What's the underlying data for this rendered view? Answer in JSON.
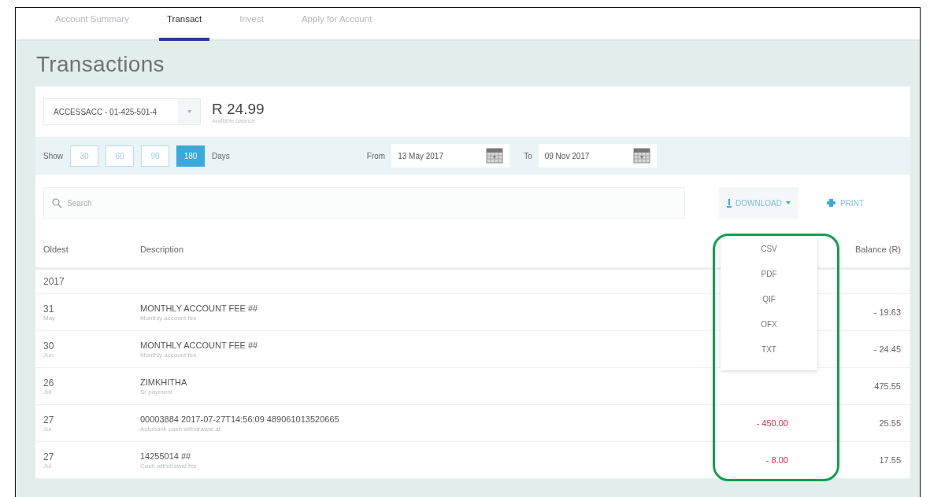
{
  "tabs": [
    {
      "label": "Account Summary",
      "selected": false
    },
    {
      "label": "Transact",
      "selected": true
    },
    {
      "label": "Invest",
      "selected": false
    },
    {
      "label": "Apply for Account",
      "selected": false
    }
  ],
  "page_title": "Transactions",
  "account": {
    "select_value": "ACCESSACC - 01-425-501-4",
    "balance": "R 24.99",
    "balance_label": "Available balance"
  },
  "filter": {
    "show_label": "Show",
    "day_options": [
      {
        "label": "30",
        "selected": false
      },
      {
        "label": "60",
        "selected": false
      },
      {
        "label": "90",
        "selected": false
      },
      {
        "label": "180",
        "selected": true
      }
    ],
    "days_label": "Days",
    "from_label": "From",
    "from_value": "13 May 2017",
    "to_label": "To",
    "to_value": "09 Nov 2017"
  },
  "search": {
    "placeholder": "Search"
  },
  "download_button": "DOWNLOAD",
  "print_button": "PRINT",
  "download_menu": [
    "CSV",
    "PDF",
    "QIF",
    "OFX",
    "TXT"
  ],
  "table": {
    "columns": [
      "Oldest",
      "Description",
      "Balance (R)"
    ],
    "year": "2017",
    "rows": [
      {
        "day": "31",
        "month": "May",
        "title": "MONTHLY ACCOUNT FEE ##",
        "subtitle": "Monthly account fee",
        "balance": "- 19.63"
      },
      {
        "day": "30",
        "month": "Jun",
        "title": "MONTHLY ACCOUNT FEE ##",
        "subtitle": "Monthly account fee",
        "balance": "- 24.45"
      },
      {
        "day": "26",
        "month": "Jul",
        "title": "ZIMKHITHA",
        "subtitle": "Sr payment",
        "balance": "475.55"
      },
      {
        "day": "27",
        "month": "Jul",
        "title": "00003884 2017-07-27T14:56:09 489061013520665",
        "subtitle": "Autobank cash withdrawal at",
        "amount": "- 450.00",
        "balance": "25.55"
      },
      {
        "day": "27",
        "month": "Jul",
        "title": "14255014 ##",
        "subtitle": "Cash withdrawal fee",
        "amount": "- 8.00",
        "balance": "17.55"
      }
    ]
  }
}
